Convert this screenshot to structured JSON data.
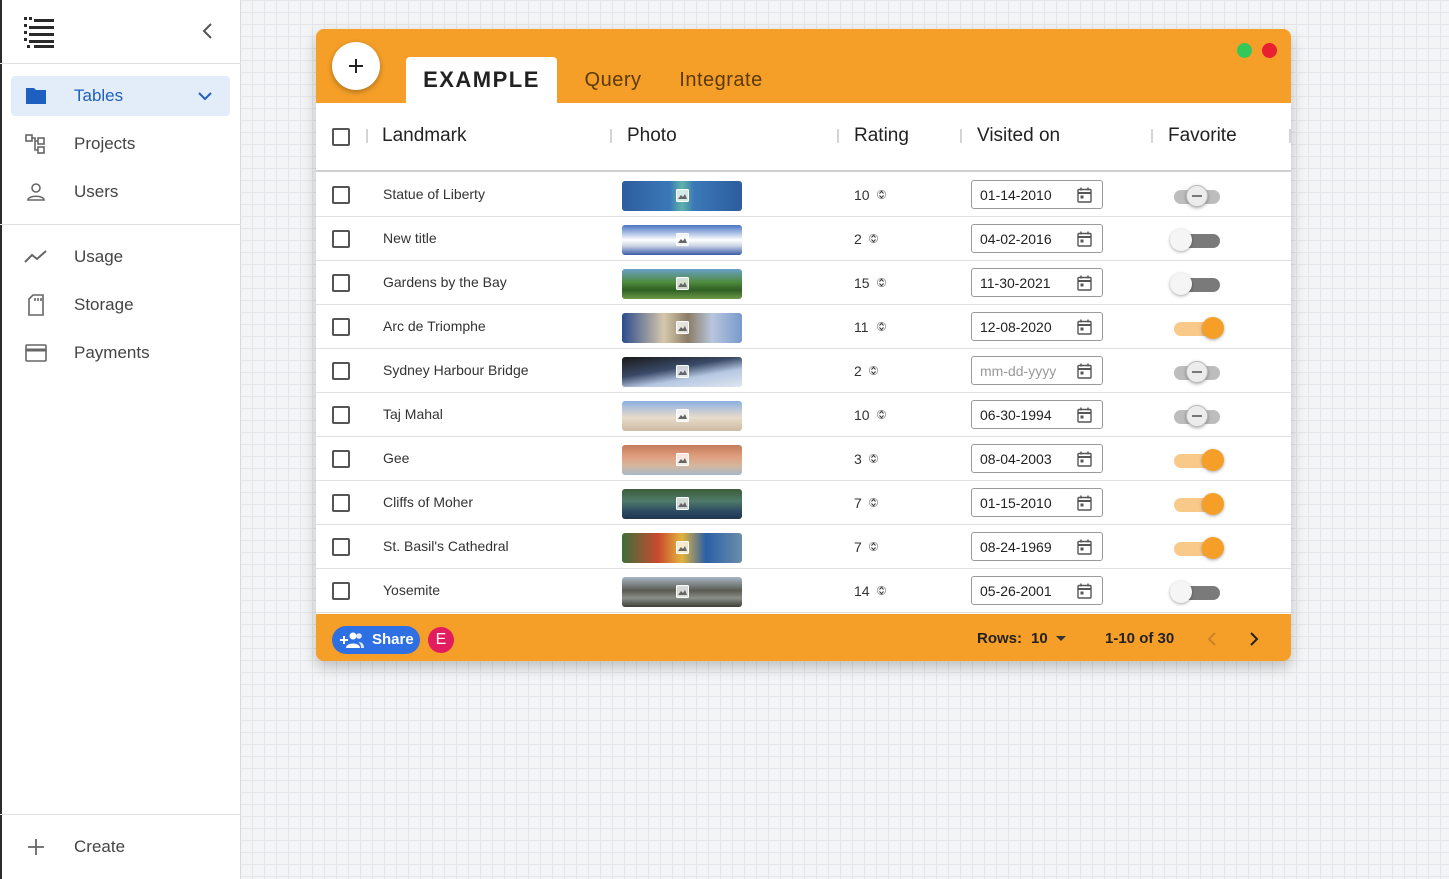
{
  "sidebar": {
    "items": [
      {
        "label": "Tables",
        "icon": "folder-icon",
        "active": true
      },
      {
        "label": "Projects",
        "icon": "hierarchy-icon"
      },
      {
        "label": "Users",
        "icon": "person-icon"
      },
      {
        "label": "Usage",
        "icon": "trend-icon"
      },
      {
        "label": "Storage",
        "icon": "sd-card-icon"
      },
      {
        "label": "Payments",
        "icon": "credit-card-icon"
      }
    ],
    "create_label": "Create"
  },
  "window": {
    "tabs": [
      "EXAMPLE",
      "Query",
      "Integrate"
    ],
    "active_tab": "EXAMPLE",
    "colors": {
      "accent": "#f59f28",
      "green_dot": "#34c759",
      "red_dot": "#e8202f"
    }
  },
  "table": {
    "columns": [
      "Landmark",
      "Photo",
      "Rating",
      "Visited on",
      "Favorite"
    ],
    "date_placeholder": "mm-dd-yyyy",
    "rows": [
      {
        "name": "Statue of Liberty",
        "rating": "10",
        "date": "01-14-2010",
        "favorite": "indeterminate"
      },
      {
        "name": "New title",
        "rating": "2",
        "date": "04-02-2016",
        "favorite": "off"
      },
      {
        "name": "Gardens by the Bay",
        "rating": "15",
        "date": "11-30-2021",
        "favorite": "off"
      },
      {
        "name": "Arc de Triomphe",
        "rating": "11",
        "date": "12-08-2020",
        "favorite": "on"
      },
      {
        "name": "Sydney Harbour Bridge",
        "rating": "2",
        "date": "",
        "favorite": "indeterminate"
      },
      {
        "name": "Taj Mahal",
        "rating": "10",
        "date": "06-30-1994",
        "favorite": "indeterminate"
      },
      {
        "name": "Gee",
        "rating": "3",
        "date": "08-04-2003",
        "favorite": "on"
      },
      {
        "name": "Cliffs of Moher",
        "rating": "7",
        "date": "01-15-2010",
        "favorite": "on"
      },
      {
        "name": "St. Basil's Cathedral",
        "rating": "7",
        "date": "08-24-1969",
        "favorite": "on"
      },
      {
        "name": "Yosemite",
        "rating": "14",
        "date": "05-26-2001",
        "favorite": "off"
      }
    ]
  },
  "footer": {
    "share_label": "Share",
    "avatar_initial": "E",
    "rows_label": "Rows:",
    "rows_value": "10",
    "range": "1-10 of 30"
  }
}
